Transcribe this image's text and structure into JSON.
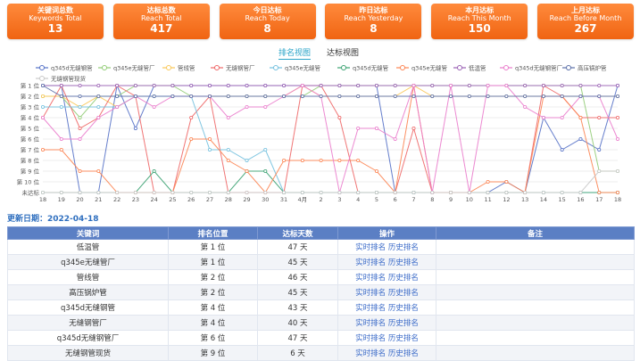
{
  "stats": [
    {
      "title": "关键词总数",
      "subtitle": "Keywords Total",
      "value": "13"
    },
    {
      "title": "达标总数",
      "subtitle": "Reach Total",
      "value": "417"
    },
    {
      "title": "今日达标",
      "subtitle": "Reach Today",
      "value": "8"
    },
    {
      "title": "昨日达标",
      "subtitle": "Reach Yesterday",
      "value": "8"
    },
    {
      "title": "本月达标",
      "subtitle": "Reach This Month",
      "value": "150"
    },
    {
      "title": "上月达标",
      "subtitle": "Reach Before Month",
      "value": "267"
    }
  ],
  "tabs": {
    "ranking": "排名视图",
    "reach": "达标视图"
  },
  "update_text": "更新日期：2022-04-18",
  "table": {
    "headers": [
      "关键词",
      "排名位置",
      "达标天数",
      "操作",
      "备注"
    ],
    "action_realtime": "实时排名",
    "action_history": "历史排名",
    "rows": [
      {
        "keyword": "低温管",
        "rank": "第 1 位",
        "days": "47 天"
      },
      {
        "keyword": "q345e无缝管厂",
        "rank": "第 1 位",
        "days": "45 天"
      },
      {
        "keyword": "管线管",
        "rank": "第 2 位",
        "days": "46 天"
      },
      {
        "keyword": "高压锅炉管",
        "rank": "第 2 位",
        "days": "45 天"
      },
      {
        "keyword": "q345d无缝钢管",
        "rank": "第 4 位",
        "days": "43 天"
      },
      {
        "keyword": "无缝钢管厂",
        "rank": "第 4 位",
        "days": "40 天"
      },
      {
        "keyword": "q345d无缝钢管厂",
        "rank": "第 6 位",
        "days": "47 天"
      },
      {
        "keyword": "无缝钢管现货",
        "rank": "第 9 位",
        "days": "6 天"
      }
    ]
  },
  "chart_data": {
    "type": "line",
    "categories": [
      "18",
      "19",
      "20",
      "21",
      "22",
      "23",
      "24",
      "25",
      "26",
      "27",
      "28",
      "29",
      "30",
      "31",
      "4月",
      "2",
      "3",
      "4",
      "5",
      "6",
      "7",
      "8",
      "9",
      "10",
      "11",
      "12",
      "13",
      "14",
      "15",
      "16",
      "17",
      "18"
    ],
    "yticks": [
      "第 1 位",
      "第 2 位",
      "第 3 位",
      "第 4 位",
      "第 5 位",
      "第 6 位",
      "第 7 位",
      "第 8 位",
      "第 9 位",
      "第 10 位",
      "未达标"
    ],
    "legend_placement": "top",
    "series": [
      {
        "name": "q345d无缝钢管",
        "color": "#5470c6",
        "values": [
          1,
          1,
          11,
          11,
          1,
          5,
          1,
          1,
          1,
          1,
          1,
          1,
          1,
          1,
          1,
          1,
          1,
          1,
          1,
          11,
          11,
          11,
          11,
          11,
          11,
          10,
          11,
          4,
          7,
          6,
          7,
          1
        ]
      },
      {
        "name": "q345e无缝管厂",
        "color": "#91cc75",
        "values": [
          2,
          2,
          4,
          2,
          2,
          1,
          1,
          1,
          2,
          2,
          2,
          2,
          2,
          2,
          2,
          1,
          1,
          1,
          1,
          1,
          1,
          1,
          1,
          1,
          1,
          1,
          1,
          1,
          1,
          1,
          9,
          9
        ]
      },
      {
        "name": "管线管",
        "color": "#fac858",
        "values": [
          2,
          2,
          3,
          2,
          3,
          2,
          2,
          2,
          2,
          2,
          2,
          2,
          2,
          2,
          1,
          2,
          2,
          2,
          2,
          2,
          1,
          2,
          2,
          2,
          2,
          2,
          2,
          2,
          2,
          2,
          2,
          2
        ]
      },
      {
        "name": "无缝钢管厂",
        "color": "#ee6666",
        "values": [
          4,
          1,
          5,
          4,
          1,
          2,
          11,
          11,
          4,
          2,
          11,
          11,
          11,
          11,
          1,
          1,
          4,
          11,
          11,
          11,
          5,
          11,
          11,
          11,
          11,
          11,
          11,
          1,
          2,
          4,
          4,
          4
        ]
      },
      {
        "name": "q345e无缝管",
        "color": "#73c0de",
        "values": [
          3,
          3,
          3,
          3,
          3,
          2,
          2,
          2,
          2,
          7,
          7,
          8,
          7,
          11,
          11,
          11,
          11,
          11,
          11,
          11,
          11,
          11,
          11,
          11,
          11,
          11,
          11,
          11,
          11,
          11,
          11,
          11
        ]
      },
      {
        "name": "q345d无缝管",
        "color": "#3ba272",
        "values": [
          11,
          11,
          11,
          11,
          11,
          11,
          9,
          11,
          11,
          11,
          11,
          9,
          9,
          11,
          11,
          11,
          11,
          11,
          11,
          11,
          11,
          11,
          11,
          11,
          11,
          11,
          11,
          11,
          11,
          11,
          11,
          11
        ]
      },
      {
        "name": "q345e无缝管",
        "color": "#fc8452",
        "values": [
          7,
          7,
          9,
          9,
          11,
          11,
          11,
          11,
          6,
          6,
          8,
          9,
          11,
          8,
          8,
          8,
          8,
          8,
          9,
          11,
          1,
          11,
          11,
          11,
          10,
          10,
          11,
          2,
          2,
          4,
          11,
          11
        ]
      },
      {
        "name": "低温管",
        "color": "#9a60b4",
        "values": [
          1,
          1,
          1,
          1,
          1,
          1,
          1,
          1,
          1,
          1,
          1,
          1,
          1,
          1,
          1,
          1,
          1,
          1,
          1,
          1,
          1,
          1,
          1,
          1,
          1,
          1,
          1,
          1,
          1,
          1,
          1,
          1
        ]
      },
      {
        "name": "q345d无缝钢管厂",
        "color": "#ea7ccc",
        "values": [
          4,
          6,
          6,
          4,
          3,
          2,
          3,
          2,
          2,
          2,
          4,
          3,
          3,
          2,
          1,
          2,
          11,
          5,
          5,
          6,
          1,
          11,
          1,
          11,
          1,
          1,
          3,
          4,
          4,
          2,
          2,
          6
        ]
      },
      {
        "name": "高压锅炉管",
        "color": "#5b6fa8",
        "values": [
          1,
          2,
          2,
          2,
          2,
          2,
          2,
          2,
          2,
          2,
          2,
          2,
          2,
          2,
          2,
          2,
          2,
          2,
          2,
          2,
          2,
          2,
          2,
          2,
          2,
          2,
          2,
          2,
          2,
          2,
          2,
          2
        ]
      },
      {
        "name": "无缝钢管现货",
        "color": "#c9c9c9",
        "values": [
          11,
          11,
          11,
          11,
          11,
          11,
          11,
          11,
          11,
          11,
          11,
          11,
          11,
          11,
          11,
          11,
          11,
          11,
          11,
          11,
          11,
          11,
          11,
          11,
          11,
          11,
          11,
          11,
          11,
          11,
          9,
          9
        ]
      }
    ]
  }
}
